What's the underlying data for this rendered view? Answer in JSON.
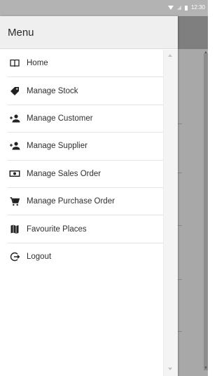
{
  "status_bar": {
    "time": "12:30",
    "icons": [
      "wifi-icon",
      "signal-icon",
      "battery-icon"
    ]
  },
  "drawer": {
    "title": "Menu",
    "items": [
      {
        "label": "Home",
        "icon": "book-icon"
      },
      {
        "label": "Manage Stock",
        "icon": "tag-icon"
      },
      {
        "label": "Manage Customer",
        "icon": "add-user-icon"
      },
      {
        "label": "Manage Supplier",
        "icon": "add-user-icon"
      },
      {
        "label": "Manage Sales Order",
        "icon": "money-icon"
      },
      {
        "label": "Manage Purchase Order",
        "icon": "cart-icon"
      },
      {
        "label": "Favourite Places",
        "icon": "map-icon"
      },
      {
        "label": "Logout",
        "icon": "logout-icon"
      }
    ]
  },
  "colors": {
    "drawer_header": "#efefef",
    "overlay": "#9a9a9a",
    "text": "#2f2f2f"
  }
}
